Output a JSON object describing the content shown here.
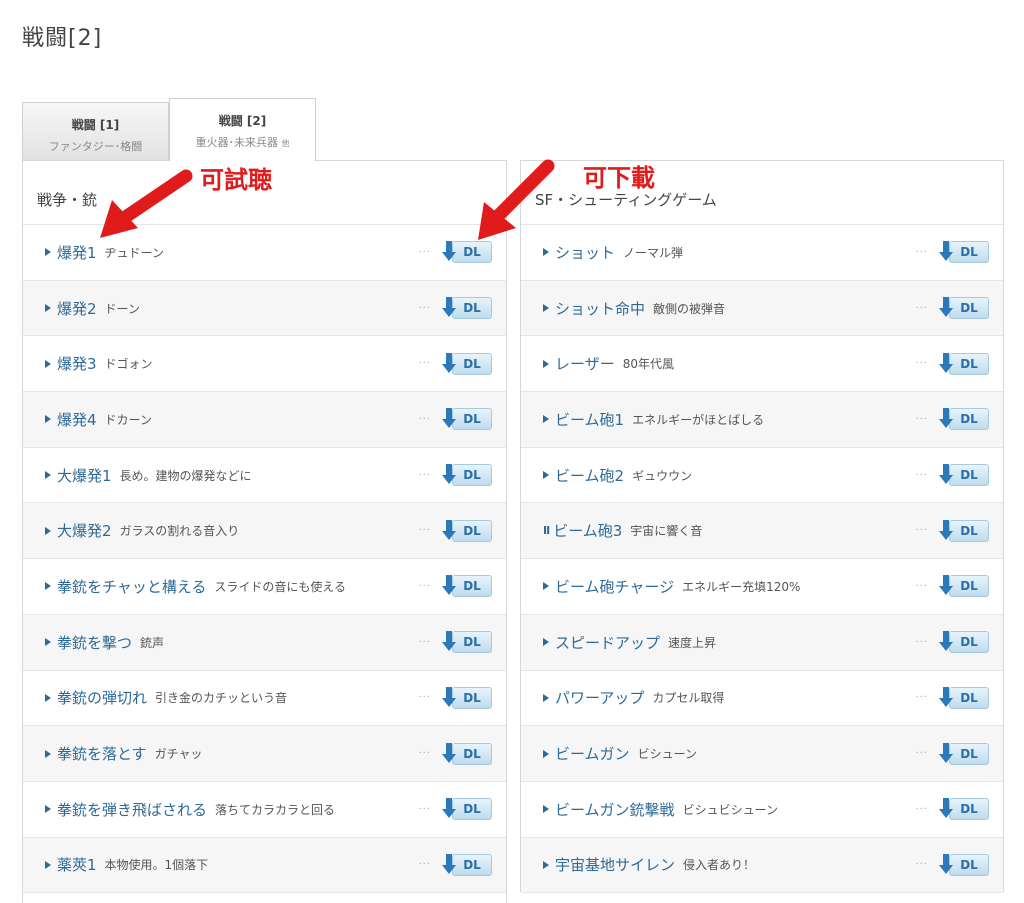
{
  "page_title": "戦闘[2]",
  "tabs": [
    {
      "title": "戦闘 [1]",
      "subtitle": "ファンタジー･格闘",
      "active": false
    },
    {
      "title": "戦闘 [2]",
      "subtitle": "重火器･未来兵器",
      "subtitle_suffix": "他",
      "active": true
    }
  ],
  "annotations": {
    "listen": "可試聴",
    "download": "可下載"
  },
  "colors": {
    "link": "#2e6a98",
    "annotation": "#e01b1b",
    "dl_button": "#2b79b8"
  },
  "dl_label": "DL",
  "dots": "···",
  "left": {
    "heading": "戦争・銃",
    "items": [
      {
        "name": "爆発1",
        "desc": "ヂュドーン",
        "state": "play"
      },
      {
        "name": "爆発2",
        "desc": "ドーン",
        "state": "play"
      },
      {
        "name": "爆発3",
        "desc": "ドゴォン",
        "state": "play"
      },
      {
        "name": "爆発4",
        "desc": "ドカーン",
        "state": "play"
      },
      {
        "name": "大爆発1",
        "desc": "長め。建物の爆発などに",
        "state": "play"
      },
      {
        "name": "大爆発2",
        "desc": "ガラスの割れる音入り",
        "state": "play"
      },
      {
        "name": "拳銃をチャッと構える",
        "desc": "スライドの音にも使える",
        "state": "play"
      },
      {
        "name": "拳銃を撃つ",
        "desc": "銃声",
        "state": "play"
      },
      {
        "name": "拳銃の弾切れ",
        "desc": "引き金のカチッという音",
        "state": "play"
      },
      {
        "name": "拳銃を落とす",
        "desc": "ガチャッ",
        "state": "play"
      },
      {
        "name": "拳銃を弾き飛ばされる",
        "desc": "落ちてカラカラと回る",
        "state": "play"
      },
      {
        "name": "薬莢1",
        "desc": "本物使用。1個落下",
        "state": "play"
      }
    ]
  },
  "right": {
    "heading": "SF・シューティングゲーム",
    "items": [
      {
        "name": "ショット",
        "desc": "ノーマル弾",
        "state": "play"
      },
      {
        "name": "ショット命中",
        "desc": "敵側の被弾音",
        "state": "play"
      },
      {
        "name": "レーザー",
        "desc": "80年代風",
        "state": "play"
      },
      {
        "name": "ビーム砲1",
        "desc": "エネルギーがほとばしる",
        "state": "play"
      },
      {
        "name": "ビーム砲2",
        "desc": "ギュウウン",
        "state": "play"
      },
      {
        "name": "ビーム砲3",
        "desc": "宇宙に響く音",
        "state": "pause"
      },
      {
        "name": "ビーム砲チャージ",
        "desc": "エネルギー充填120%",
        "state": "play"
      },
      {
        "name": "スピードアップ",
        "desc": "速度上昇",
        "state": "play"
      },
      {
        "name": "パワーアップ",
        "desc": "カプセル取得",
        "state": "play"
      },
      {
        "name": "ビームガン",
        "desc": "ビシューン",
        "state": "play"
      },
      {
        "name": "ビームガン銃撃戦",
        "desc": "ビシュビシューン",
        "state": "play"
      },
      {
        "name": "宇宙基地サイレン",
        "desc": "侵入者あり！",
        "state": "play"
      }
    ]
  }
}
